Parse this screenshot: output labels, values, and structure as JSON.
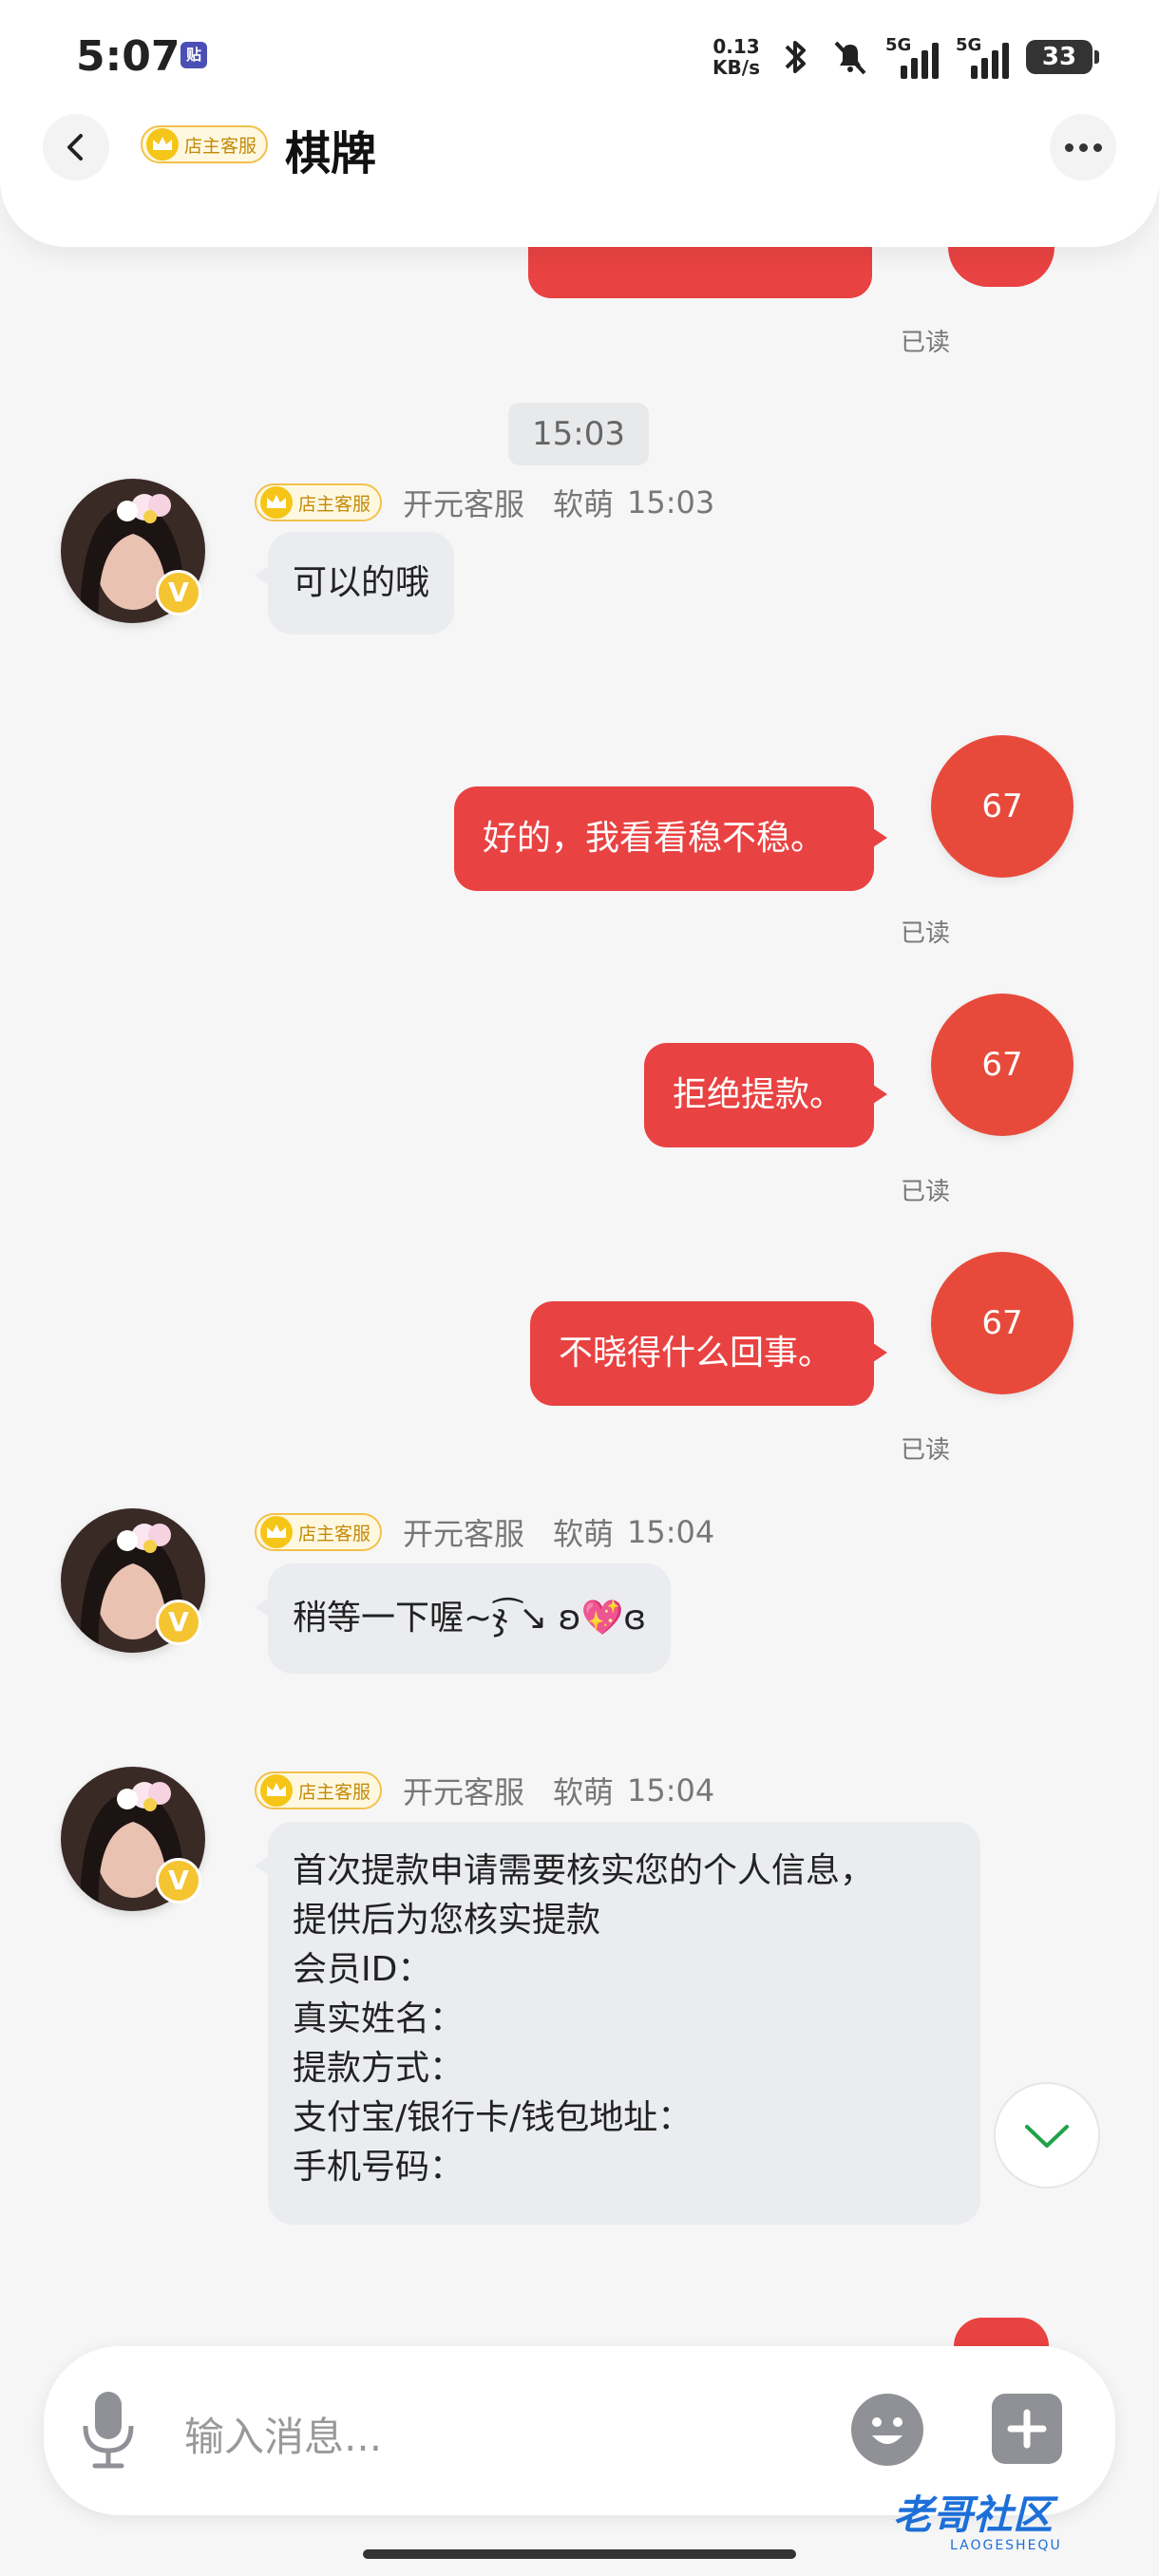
{
  "status_bar": {
    "time": "5:07",
    "app_icon_text": "贴",
    "net_speed_value": "0.13",
    "net_speed_unit": "KB/s",
    "sim1_label": "5G",
    "sim2_label": "5G",
    "battery": "33"
  },
  "header": {
    "badge_text": "店主客服",
    "title": "棋牌"
  },
  "time_divider": "15:03",
  "me_avatar_text": "67",
  "read_label": "已读",
  "sender": {
    "badge_text": "店主客服",
    "name": "开元客服",
    "nickname": "软萌",
    "v_badge": "V"
  },
  "messages": [
    {
      "from": "them",
      "time": "15:03",
      "text": "可以的哦"
    },
    {
      "from": "me",
      "text": "好的，我看看稳不稳。"
    },
    {
      "from": "me",
      "text": "拒绝提款。"
    },
    {
      "from": "me",
      "text": "不晓得什么回事。"
    },
    {
      "from": "them",
      "time": "15:04",
      "text": "稍等一下喔~ჯ͡ ↘ ʚ💖ɞ"
    },
    {
      "from": "them",
      "time": "15:04",
      "lines": [
        "首次提款申请需要核实您的个人信息，",
        "提供后为您核实提款",
        "会员ID：",
        "真实姓名：",
        "提款方式：",
        "支付宝/银行卡/钱包地址：",
        "手机号码："
      ]
    }
  ],
  "input": {
    "placeholder": "输入消息..."
  },
  "watermark": {
    "text": "老哥社区",
    "sub": "LAOGESHEQU"
  },
  "colors": {
    "outgoing_bubble": "#e94242",
    "incoming_bubble": "#eaecef",
    "badge_gold": "#f5c518"
  },
  "icons": {
    "back": "chevron-left-icon",
    "more": "ellipsis-icon",
    "mic": "microphone-icon",
    "emoji": "smiley-icon",
    "plus": "plus-icon",
    "scroll_down": "chevron-down-icon"
  }
}
